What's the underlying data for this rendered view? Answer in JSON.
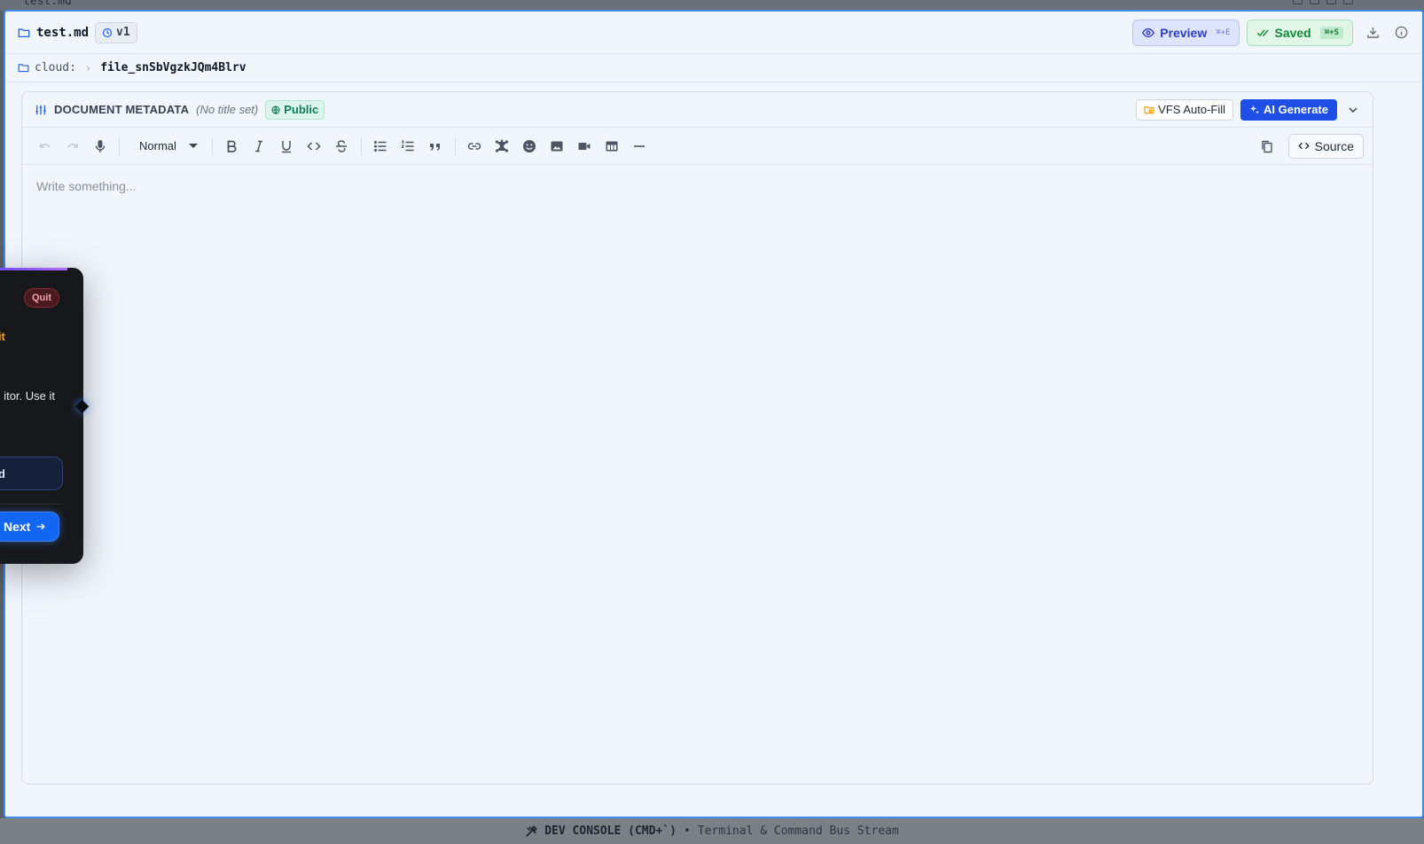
{
  "background": {
    "tab_label": "test.md"
  },
  "header": {
    "filename": "test.md",
    "version": "v1",
    "preview_label": "Preview",
    "preview_shortcut": "⌘+E",
    "saved_label": "Saved",
    "saved_shortcut": "⌘+S"
  },
  "breadcrumb": {
    "root": "cloud:",
    "separator": "›",
    "current": "file_snSbVgzkJQm4Blrv"
  },
  "metadata": {
    "title": "DOCUMENT METADATA",
    "no_title": "(No title set)",
    "visibility": "Public",
    "vfs_autofill_label": "VFS Auto-Fill",
    "ai_generate_label": "AI Generate"
  },
  "toolbar": {
    "block_style": "Normal",
    "source_label": "Source"
  },
  "editor": {
    "placeholder": "Write something..."
  },
  "tour": {
    "quit_label": "Quit",
    "step_title_partial": "dit",
    "body_partial": "itor. Use it",
    "option_partial": "ed",
    "next_label": "Next"
  },
  "dev_console": {
    "title": "DEV CONSOLE (CMD+`)",
    "separator": "•",
    "subtitle": "Terminal & Command Bus Stream"
  },
  "colors": {
    "accent": "#1f4fe6",
    "window_border": "#3b8eea",
    "saved_green": "#138a3b",
    "public_green": "#0e7a55",
    "quit_red": "#8b2a36",
    "step_orange": "#f5a524"
  }
}
